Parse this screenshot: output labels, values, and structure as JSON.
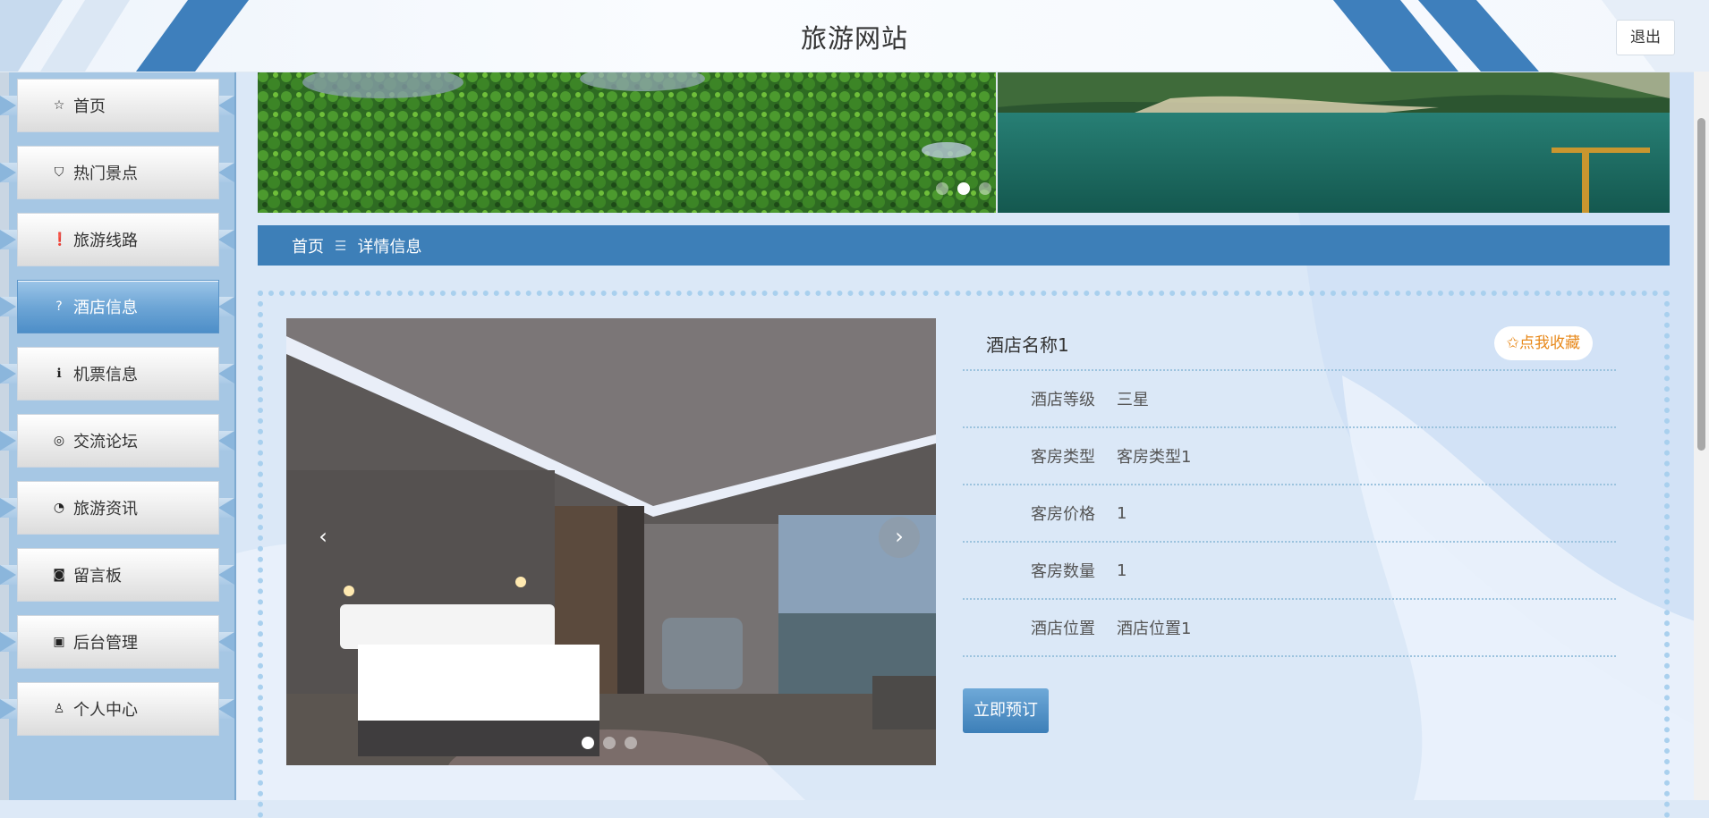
{
  "header": {
    "site_title": "旅游网站",
    "logout_label": "退出"
  },
  "sidebar": {
    "items": [
      {
        "label": "首页",
        "icon": "star-icon",
        "glyph": "☆",
        "active": false
      },
      {
        "label": "热门景点",
        "icon": "bag-icon",
        "glyph": "⛉",
        "active": false
      },
      {
        "label": "旅游线路",
        "icon": "exclamation-circle-icon",
        "glyph": "❗",
        "active": false
      },
      {
        "label": "酒店信息",
        "icon": "question-circle-icon",
        "glyph": "?",
        "active": true
      },
      {
        "label": "机票信息",
        "icon": "info-circle-icon",
        "glyph": "ℹ",
        "active": false
      },
      {
        "label": "交流论坛",
        "icon": "ring-icon",
        "glyph": "◎",
        "active": false
      },
      {
        "label": "旅游资讯",
        "icon": "chart-circle-icon",
        "glyph": "◔",
        "active": false
      },
      {
        "label": "留言板",
        "icon": "camera-icon",
        "glyph": "◙",
        "active": false
      },
      {
        "label": "后台管理",
        "icon": "gift-icon",
        "glyph": "▣",
        "active": false
      },
      {
        "label": "个人中心",
        "icon": "user-icon",
        "glyph": "♙",
        "active": false
      }
    ]
  },
  "banner": {
    "slide_count": 3,
    "active_slide": 2
  },
  "breadcrumb": {
    "home": "首页",
    "separator": "☰",
    "current": "详情信息"
  },
  "detail": {
    "hotel_name": "酒店名称1",
    "favorite_label": "✩点我收藏",
    "fields": [
      {
        "key": "酒店等级",
        "value": "三星"
      },
      {
        "key": "客房类型",
        "value": "客房类型1"
      },
      {
        "key": "客房价格",
        "value": "1"
      },
      {
        "key": "客房数量",
        "value": "1"
      },
      {
        "key": "酒店位置",
        "value": "酒店位置1"
      }
    ],
    "book_label": "立即预订",
    "carousel": {
      "slide_count": 3,
      "active_slide": 1,
      "prev": "‹",
      "next": "›"
    }
  },
  "colors": {
    "accent": "#3d7fb8",
    "favorite": "#e8891b",
    "sidebar_bg": "#a6c7e4"
  }
}
